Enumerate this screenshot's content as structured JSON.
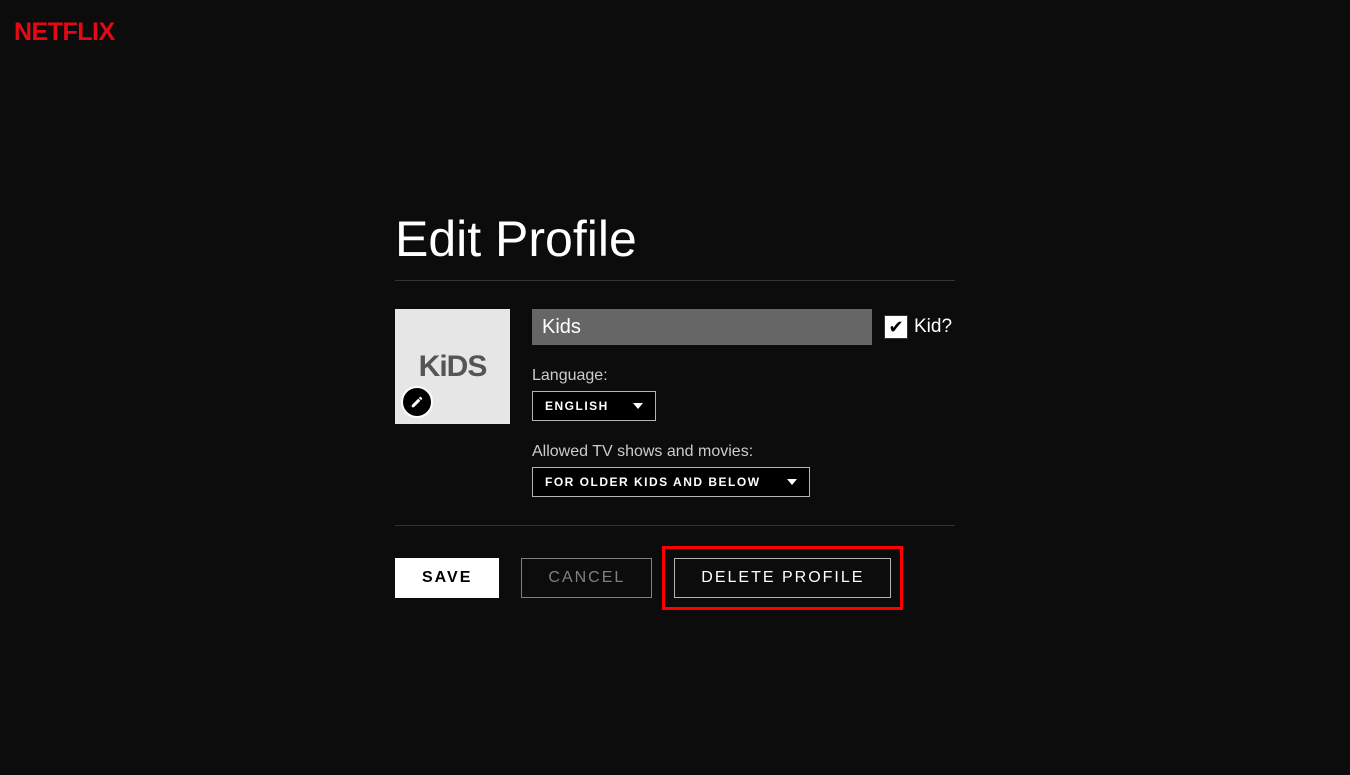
{
  "brand": {
    "logo_text": "NETFLIX",
    "accent_color": "#e50914"
  },
  "page": {
    "title": "Edit Profile"
  },
  "avatar": {
    "display_text": "KiDS"
  },
  "form": {
    "name_value": "Kids",
    "kid_checkbox_label": "Kid?",
    "kid_checkbox_checked": true,
    "language_label": "Language:",
    "language_value": "English",
    "maturity_label": "Allowed TV shows and movies:",
    "maturity_value": "For Older Kids and Below"
  },
  "buttons": {
    "save": "Save",
    "cancel": "Cancel",
    "delete": "Delete Profile"
  },
  "annotation": {
    "highlight_target": "delete-profile-button"
  }
}
